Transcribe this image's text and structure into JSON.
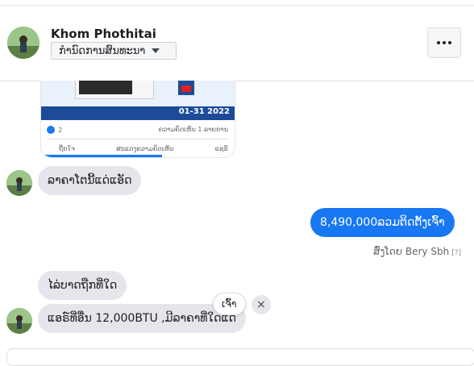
{
  "header": {
    "contact_name": "Khom Phothitai",
    "manage_label": "ກຳນົດການສົນທະນາ",
    "more_label": "More options"
  },
  "shared_post": {
    "ad_date": "01-31 2022",
    "reactions_count": "2",
    "comments_label": "ຄວາມຄິດເຫັນ 1 ລາຍການ",
    "actions": [
      "ຖືກໃຈ",
      "ສະແດງຄວາມຄິດເຫັນ",
      "ແຊຣ໌"
    ]
  },
  "messages": [
    {
      "direction": "in",
      "text": "ລາຄາໂຕນີ້ແດ່ແອັດ"
    },
    {
      "direction": "out",
      "text": "8,490,000ລວມຕິດຕັ້ງເຈົ້າ"
    },
    {
      "direction": "in",
      "text": "ໄລ່ບາດຖືກທີ່ໃດ"
    },
    {
      "direction": "in",
      "text": "ແອຣ໌ທີ່ອື່ນ 12,000BTU ,ມີລາຄາທີ່ໃດແດ່"
    }
  ],
  "sent_by": {
    "label": "ສົ່ງໂດຍ Bery Sbh",
    "help": "[?]"
  },
  "quick_reply": "ເຈົ້າ",
  "close_icon": "×",
  "colors": {
    "accent": "#1877f2",
    "incoming_bubble": "#e4e6eb"
  }
}
